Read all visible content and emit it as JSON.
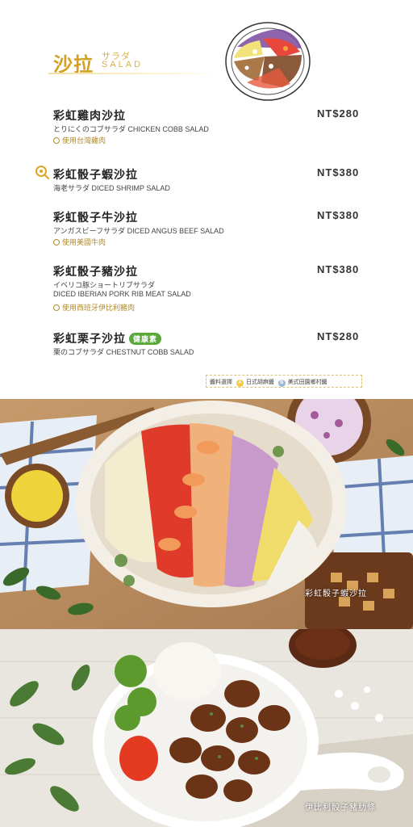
{
  "header": {
    "title_zh": "沙拉",
    "title_jp": "サラダ",
    "title_en": "SALAD"
  },
  "items": [
    {
      "name": "彩虹雞肉沙拉",
      "price": "NT$280",
      "sub": "とりにくのコブサラダ  CHICKEN COBB SALAD",
      "note": "使用台灣雞肉"
    },
    {
      "name": "彩虹骰子蝦沙拉",
      "price": "NT$380",
      "sub": "海老サラダ  DICED SHRIMP SALAD"
    },
    {
      "name": "彩虹骰子牛沙拉",
      "price": "NT$380",
      "sub": "アンガスビーフサラダ  DICED ANGUS BEEF SALAD",
      "note": "使用美國牛肉"
    },
    {
      "name": "彩虹骰子豬沙拉",
      "price": "NT$380",
      "sub": "イベリコ豚ショートリブサラダ",
      "sub2": "DICED IBERIAN PORK RIB MEAT SALAD",
      "note": "使用西班牙伊比利豬肉"
    },
    {
      "name": "彩虹栗子沙拉",
      "price": "NT$280",
      "sub": "栗のコブサラダ  CHESTNUT COBB SALAD",
      "badge": "健康素"
    }
  ],
  "sauce": {
    "label": "醬料選擇",
    "a_mark": "A",
    "a_label": "日式胡麻醬",
    "b_mark": "B",
    "b_label": "美式田園鄉村醬"
  },
  "photos": {
    "caption1": "彩虹骰子蝦沙拉",
    "caption2": "伊比利骰子豬肋條"
  },
  "colors": {
    "gold": "#d3a020",
    "badge_green": "#5aa83a"
  },
  "icons": [
    "recommend-icon",
    "location-pin-icon",
    "bowl-illustration"
  ]
}
